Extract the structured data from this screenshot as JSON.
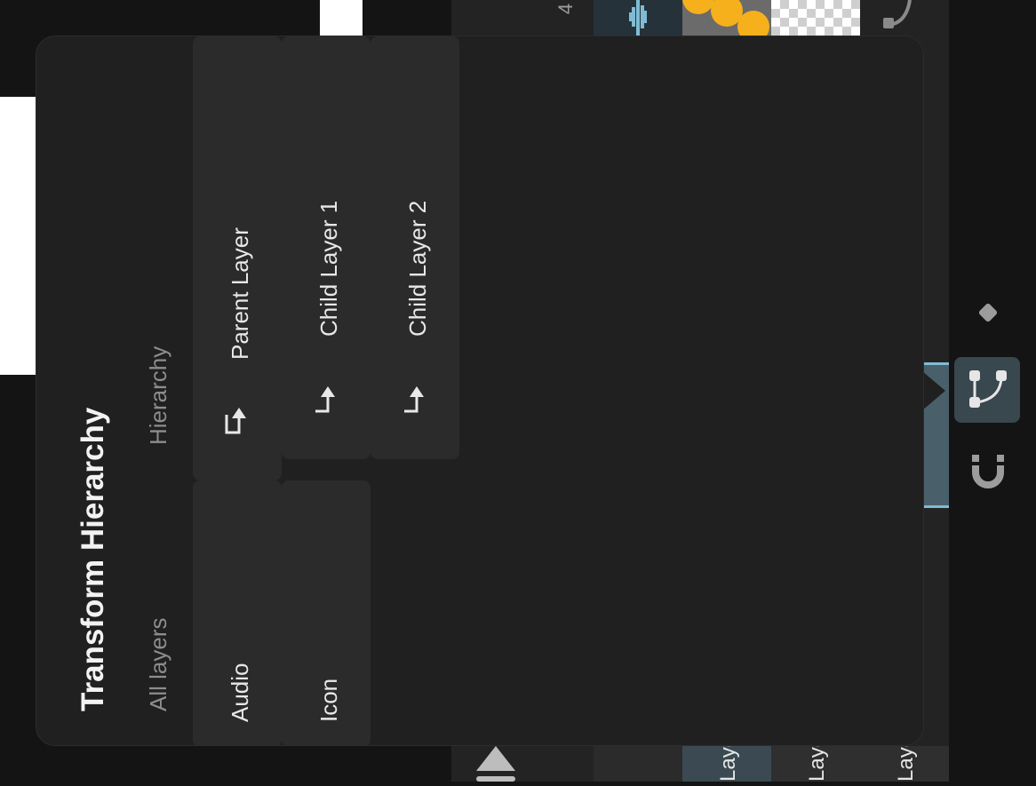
{
  "background": {
    "frame_number": "4",
    "bottom_tabs": [
      "Laye",
      "Laye",
      "Laye"
    ]
  },
  "popover": {
    "title": "Transform Hierarchy",
    "tabs": {
      "all_layers": "All layers",
      "hierarchy": "Hierarchy"
    },
    "hierarchy_items": [
      {
        "label": "Parent Layer",
        "icon": "return-arrow-icon"
      },
      {
        "label": "Child Layer 1",
        "icon": "return-arrow-icon"
      },
      {
        "label": "Child Layer 2",
        "icon": "return-arrow-icon"
      }
    ],
    "all_layers_items": [
      {
        "label": "Audio"
      },
      {
        "label": "Icon"
      }
    ]
  },
  "toolbar": {
    "icons": [
      "keyframe-diamond-icon",
      "bezier-path-icon",
      "magnet-icon"
    ],
    "active": "bezier-path-icon"
  },
  "colors": {
    "accent": "#7fbcd4",
    "dot_orange": "#f6b01c",
    "panel_bg": "#202020",
    "card_bg": "#2b2b2b"
  }
}
